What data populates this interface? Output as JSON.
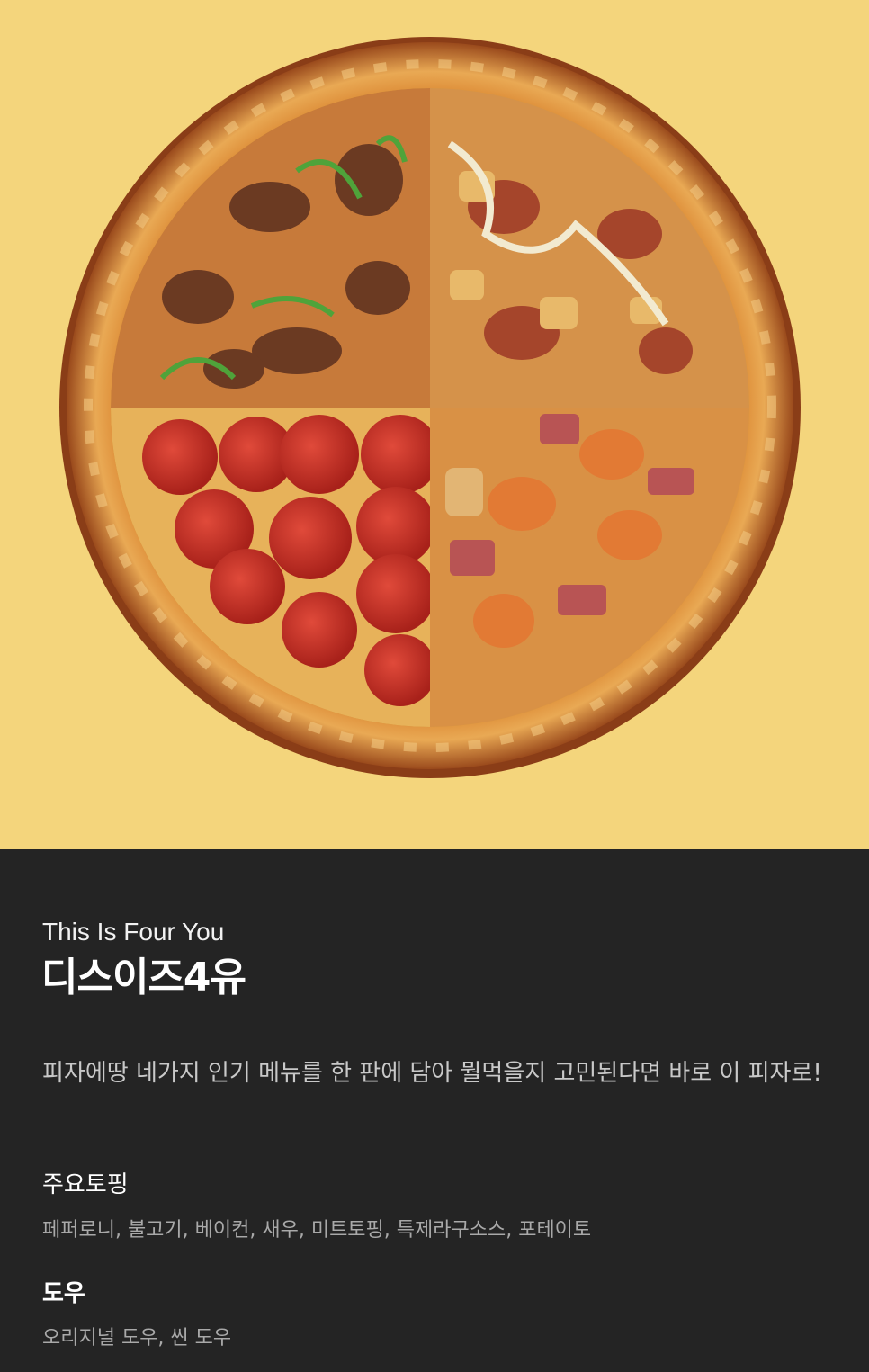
{
  "hero": {
    "image": "pizza-four-quarters",
    "background_color": "#f4d57c"
  },
  "product": {
    "subtitle_en": "This Is Four You",
    "title": "디스이즈4유",
    "description": "피자에땅 네가지 인기 메뉴를 한 판에 담아 뭘먹을지 고민된다면 바로 이 피자로!"
  },
  "details": {
    "toppings_label": "주요토핑",
    "toppings_value": "페퍼로니, 불고기, 베이컨, 새우, 미트토핑, 특제라구소스, 포테이토",
    "dough_label": "도우",
    "dough_value": "오리지널 도우, 씬 도우"
  }
}
